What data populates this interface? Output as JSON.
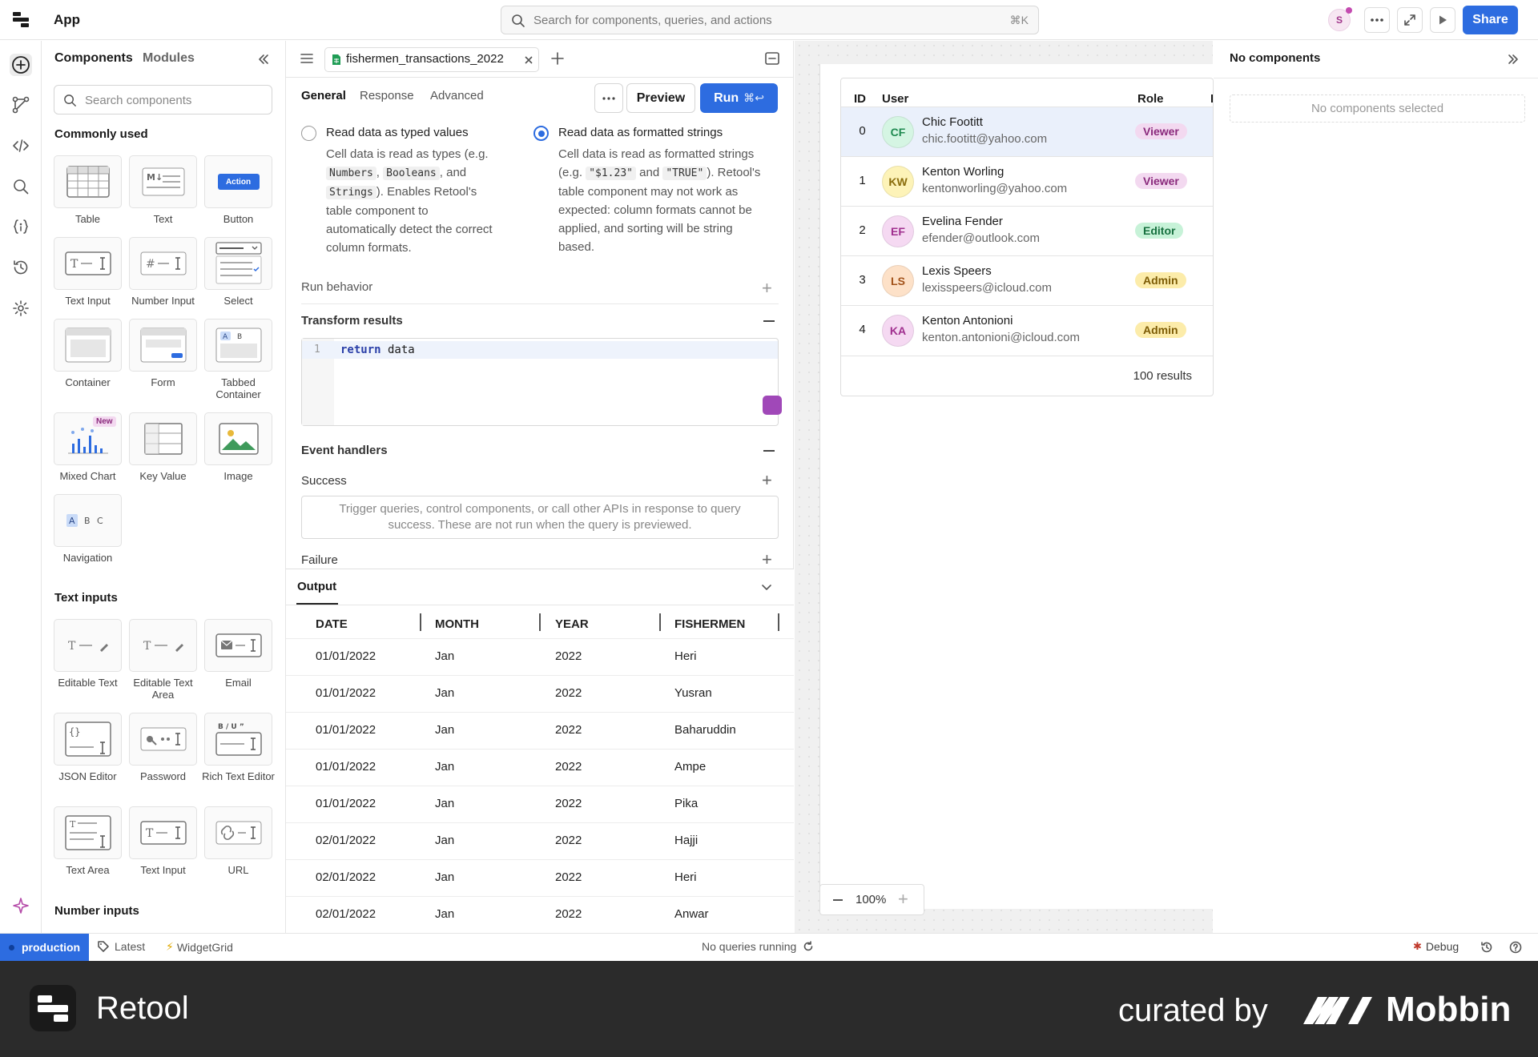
{
  "topbar": {
    "app_title": "App",
    "search_placeholder": "Search for components, queries, and actions",
    "search_shortcut": "⌘K",
    "avatar_initial": "S",
    "share_label": "Share"
  },
  "components_panel": {
    "tabs": [
      "Components",
      "Modules"
    ],
    "search_placeholder": "Search components",
    "sections": {
      "commonly_used": "Commonly used",
      "text_inputs": "Text inputs",
      "number_inputs": "Number inputs"
    },
    "commonly_used": [
      "Table",
      "Text",
      "Button",
      "Text Input",
      "Number Input",
      "Select",
      "Container",
      "Form",
      "Tabbed Container",
      "Mixed Chart",
      "Key Value",
      "Image",
      "Navigation"
    ],
    "button_tile_text": "Action",
    "new_badge": "New",
    "text_inputs": [
      "Editable Text",
      "Editable Text Area",
      "Email",
      "JSON Editor",
      "Password",
      "Rich Text Editor",
      "Text Area",
      "Text Input",
      "URL"
    ]
  },
  "query": {
    "file_tab": "fishermen_transactions_2022",
    "subtabs": [
      "General",
      "Response",
      "Advanced"
    ],
    "preview_label": "Preview",
    "run_label": "Run",
    "run_shortcut": "⌘↩",
    "option_typed": {
      "title": "Read data as typed values",
      "desc_1": "Cell data is read as types (e.g.",
      "code_1": "Numbers",
      "code_2": "Booleans",
      "and": ", and",
      "code_3": "Strings",
      "desc_2": "). Enables Retool's",
      "desc_3": "table component to",
      "desc_4": "automatically detect the correct",
      "desc_5": "column formats."
    },
    "option_formatted": {
      "title": "Read data as formatted strings",
      "desc_1": "Cell data is read as formatted strings",
      "eg": "(e.g.",
      "code_1": "\"$1.23\"",
      "and": "and",
      "code_2": "\"TRUE\"",
      "desc_2": "). Retool's",
      "desc_3": "table component may not work as",
      "desc_4": "expected: column formats cannot be",
      "desc_5": "applied, and sorting will be string",
      "desc_6": "based."
    },
    "run_behavior": "Run behavior",
    "transform_results": "Transform results",
    "code_line_no": "1",
    "code_keyword": "return",
    "code_rest": " data",
    "event_handlers": "Event handlers",
    "success": "Success",
    "handler_hint_1": "Trigger queries, control components, or call other APIs in response to query",
    "handler_hint_2": "success. These are not run when the query is previewed.",
    "failure": "Failure"
  },
  "output": {
    "title": "Output",
    "columns": [
      "DATE",
      "MONTH",
      "YEAR",
      "FISHERMEN"
    ],
    "rows": [
      [
        "01/01/2022",
        "Jan",
        "2022",
        "Heri"
      ],
      [
        "01/01/2022",
        "Jan",
        "2022",
        "Yusran"
      ],
      [
        "01/01/2022",
        "Jan",
        "2022",
        "Baharuddin"
      ],
      [
        "01/01/2022",
        "Jan",
        "2022",
        "Ampe"
      ],
      [
        "01/01/2022",
        "Jan",
        "2022",
        "Pika"
      ],
      [
        "02/01/2022",
        "Jan",
        "2022",
        "Hajji"
      ],
      [
        "02/01/2022",
        "Jan",
        "2022",
        "Heri"
      ],
      [
        "02/01/2022",
        "Jan",
        "2022",
        "Anwar"
      ]
    ]
  },
  "canvas": {
    "table_headers": [
      "ID",
      "User",
      "Role",
      "E"
    ],
    "users": [
      {
        "id": "0",
        "initials": "CF",
        "name": "Chic Footitt",
        "email": "chic.footitt@yahoo.com",
        "role": "Viewer",
        "avatar_bg": "#d5f5e3",
        "avatar_fg": "#1f8a50",
        "role_bg": "#f3d9f0",
        "role_fg": "#8a2a7c"
      },
      {
        "id": "1",
        "initials": "KW",
        "name": "Kenton Worling",
        "email": "kentonworling@yahoo.com",
        "role": "Viewer",
        "avatar_bg": "#fdf3b8",
        "avatar_fg": "#8a6d0c",
        "role_bg": "#f3d9f0",
        "role_fg": "#8a2a7c"
      },
      {
        "id": "2",
        "initials": "EF",
        "name": "Evelina Fender",
        "email": "efender@outlook.com",
        "role": "Editor",
        "avatar_bg": "#f5d9f2",
        "avatar_fg": "#a02f8f",
        "role_bg": "#c7f2d8",
        "role_fg": "#17703f"
      },
      {
        "id": "3",
        "initials": "LS",
        "name": "Lexis Speers",
        "email": "lexisspeers@icloud.com",
        "role": "Admin",
        "avatar_bg": "#fde1c8",
        "avatar_fg": "#a2521a",
        "role_bg": "#fcecaa",
        "role_fg": "#7d5c06"
      },
      {
        "id": "4",
        "initials": "KA",
        "name": "Kenton Antonioni",
        "email": "kenton.antonioni@icloud.com",
        "role": "Admin",
        "avatar_bg": "#f5d9f2",
        "avatar_fg": "#a02f8f",
        "role_bg": "#fcecaa",
        "role_fg": "#7d5c06"
      }
    ],
    "results_count": "100 results",
    "zoom_level": "100%"
  },
  "inspector": {
    "title": "No components",
    "empty_text": "No components selected"
  },
  "status_bar": {
    "environment": "production",
    "version": "Latest",
    "widget": "WidgetGrid",
    "queries_status": "No queries running",
    "debug_label": "Debug"
  },
  "banner": {
    "brand": "Retool",
    "curated_by": "curated by",
    "curator": "Mobbin"
  },
  "colors": {
    "accent": "#2d6ce0",
    "highlight_row": "#eaf0fb",
    "banner_bg": "#2b2b2b"
  }
}
